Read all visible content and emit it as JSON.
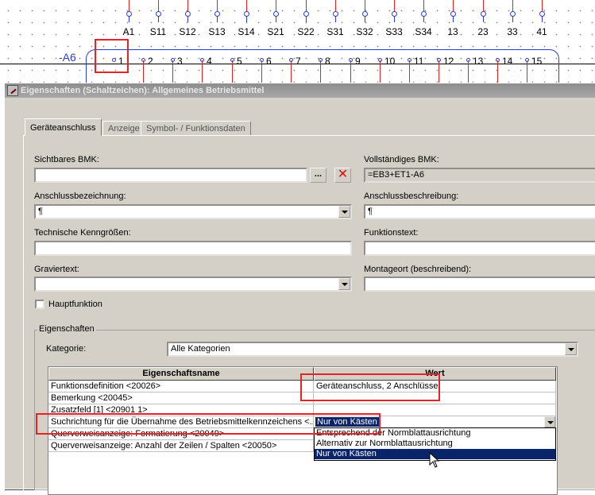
{
  "schematic": {
    "device_tag": "-A6",
    "top_labels": [
      "A1",
      "S11",
      "S12",
      "S13",
      "S14",
      "S21",
      "S22",
      "S31",
      "S32",
      "S33",
      "S34",
      "13",
      "23",
      "33",
      "41"
    ],
    "terminals": [
      "1",
      "2",
      "3",
      "4",
      "5",
      "6",
      "7",
      "8",
      "9",
      "10",
      "11",
      "12",
      "13",
      "14",
      "15"
    ]
  },
  "dialog": {
    "title": "Eigenschaften (Schaltzeichen): Allgemeines Betriebsmittel",
    "tabs": [
      {
        "label": "Geräteanschluss"
      },
      {
        "label": "Anzeige"
      },
      {
        "label": "Symbol- / Funktionsdaten"
      }
    ],
    "fields": {
      "sichtbares_bmk_label": "Sichtbares BMK:",
      "sichtbares_bmk_value": "",
      "browse_button": "...",
      "vollstaendiges_bmk_label": "Vollständiges BMK:",
      "vollstaendiges_bmk_value": "=EB3+ET1-A6",
      "anschlussbezeichnung_label": "Anschlussbezeichnung:",
      "anschlussbezeichnung_value": "¶",
      "anschlussbeschreibung_label": "Anschlussbeschreibung:",
      "anschlussbeschreibung_value": "¶",
      "technische_kenngroessen_label": "Technische Kenngrößen:",
      "technische_kenngroessen_value": "",
      "funktionstext_label": "Funktionstext:",
      "funktionstext_value": "",
      "graviertext_label": "Graviertext:",
      "graviertext_value": "",
      "montageort_label": "Montageort (beschreibend):",
      "montageort_value": "",
      "hauptfunktion_label": "Hauptfunktion"
    },
    "eigenschaften": {
      "group_label": "Eigenschaften",
      "kategorie_label": "Kategorie:",
      "kategorie_value": "Alle Kategorien",
      "columns": [
        "Eigenschaftsname",
        "Wert"
      ],
      "rows": [
        {
          "name": "Funktionsdefinition <20026>",
          "value": "Geräteanschluss, 2 Anschlüsse"
        },
        {
          "name": "Bemerkung <20045>",
          "value": ""
        },
        {
          "name": "Zusatzfeld [1] <20901 1>",
          "value": ""
        },
        {
          "name": "Suchrichtung für die Übernahme des Betriebsmittelkennzeichens <...",
          "value": "Nur von Kästen"
        },
        {
          "name": "Querverweisanzeige: Formatierung <20049>",
          "value": ""
        },
        {
          "name": "Querverweisanzeige: Anzahl der Zeilen / Spalten <20050>",
          "value": ""
        }
      ],
      "dropdown_options": [
        "Entsprechend der Normblattausrichtung",
        "Alternativ zur Normblattausrichtung",
        "Nur von Kästen"
      ]
    }
  },
  "colors": {
    "highlight_red": "#e3252a",
    "schematic_blue": "#2a3fc6",
    "selection_blue": "#0a246a"
  }
}
